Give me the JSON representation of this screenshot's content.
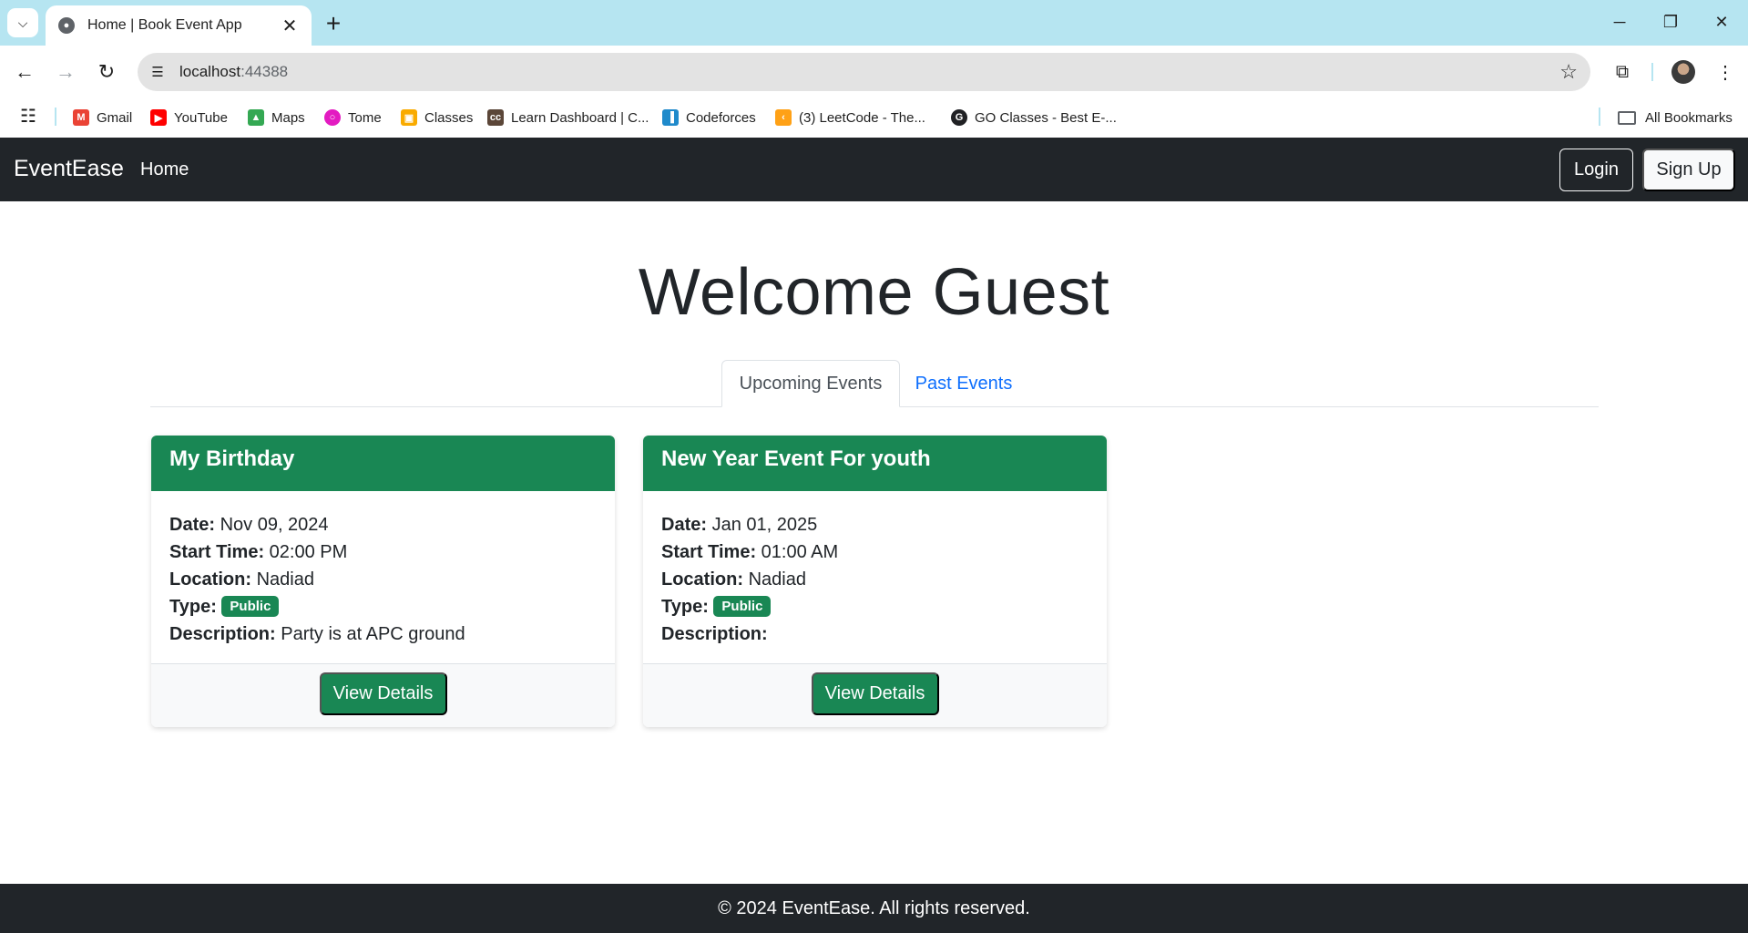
{
  "browser": {
    "tab_title": "Home | Book Event App",
    "url_host": "localhost",
    "url_port": ":44388",
    "icons": {
      "tab_search": "chevron-down-icon",
      "favicon": "globe-icon",
      "tab_close": "close-icon",
      "new_tab": "plus-icon",
      "back": "back-arrow-icon",
      "forward": "forward-arrow-icon",
      "reload": "reload-icon",
      "site_info": "tune-icon",
      "bookmark_star": "star-icon",
      "extensions": "puzzle-icon",
      "menu": "kebab-menu-icon"
    },
    "bookmarks": [
      {
        "label": "Gmail",
        "icon": "gmail-icon"
      },
      {
        "label": "YouTube",
        "icon": "youtube-icon"
      },
      {
        "label": "Maps",
        "icon": "maps-icon"
      },
      {
        "label": "Tome",
        "icon": "tome-icon"
      },
      {
        "label": "Classes",
        "icon": "classroom-icon"
      },
      {
        "label": "Learn Dashboard | C...",
        "icon": "codechef-icon"
      },
      {
        "label": "Codeforces",
        "icon": "codeforces-icon"
      },
      {
        "label": "(3) LeetCode - The...",
        "icon": "leetcode-icon"
      },
      {
        "label": "GO Classes - Best E-...",
        "icon": "google-icon"
      }
    ],
    "all_bookmarks": "All Bookmarks"
  },
  "navbar": {
    "brand": "EventEase",
    "home": "Home",
    "login": "Login",
    "signup": "Sign Up"
  },
  "main": {
    "heading": "Welcome Guest",
    "tabs": [
      {
        "label": "Upcoming Events",
        "active": true
      },
      {
        "label": "Past Events",
        "active": false
      }
    ]
  },
  "events": [
    {
      "title": "My Birthday",
      "date_label": "Date:",
      "date": "Nov 09, 2024",
      "time_label": "Start Time:",
      "time": "02:00 PM",
      "location_label": "Location:",
      "location": "Nadiad",
      "type_label": "Type:",
      "type": "Public",
      "description_label": "Description:",
      "description": "Party is at APC ground",
      "button": "View Details"
    },
    {
      "title": "New Year Event For youth",
      "date_label": "Date:",
      "date": "Jan 01, 2025",
      "time_label": "Start Time:",
      "time": "01:00 AM",
      "location_label": "Location:",
      "location": "Nadiad",
      "type_label": "Type:",
      "type": "Public",
      "description_label": "Description:",
      "description": "",
      "button": "View Details"
    }
  ],
  "footer": {
    "text": "© 2024 EventEase. All rights reserved."
  },
  "colors": {
    "primary_green": "#198754",
    "navbar_dark": "#212529",
    "link_blue": "#0d6efd",
    "browser_frame": "#b6e5f1"
  }
}
